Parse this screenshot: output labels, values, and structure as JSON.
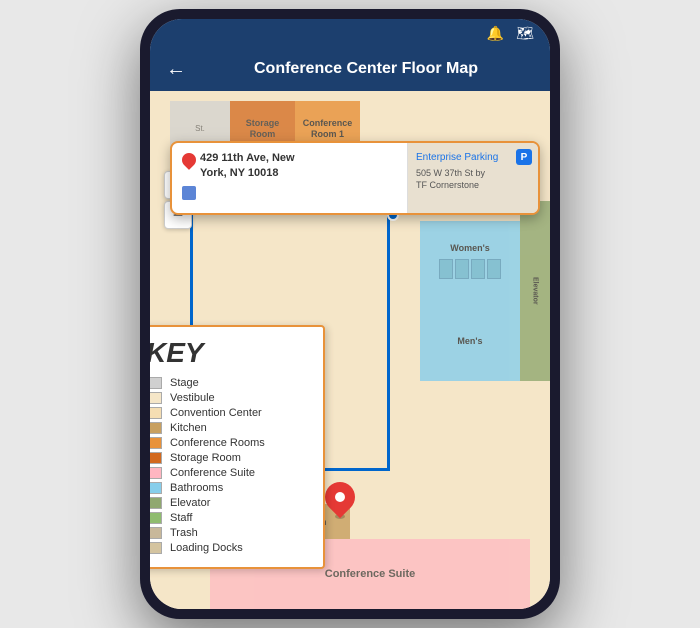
{
  "phone": {
    "nav": {
      "back_label": "←",
      "title": "Conference Center Floor Map",
      "bell_icon": "🔔",
      "map_icon": "🗺"
    }
  },
  "map": {
    "rooms": {
      "storage": "Storage\nRoom",
      "conf1": "Conference\nRoom 1",
      "stage": "St.",
      "womens": "Women's",
      "mens": "Men's",
      "elevator": "Elevator",
      "kitchen": "Kitchen",
      "conf_suite": "Conference Suite"
    },
    "popup": {
      "address_line1": "429 11th Ave, New",
      "address_line2": "York, NY 10018",
      "parking_label": "P",
      "enterprise_line1": "Enterprise Parking",
      "cornerstone_text": "505 W 37th St by\nTF Cornerstone"
    },
    "controls": {
      "zoom_in": "+",
      "zoom_out": "−"
    }
  },
  "key": {
    "title": "KEY",
    "items": [
      {
        "label": "Stage",
        "color": "#d0d0d0"
      },
      {
        "label": "Vestibule",
        "color": "#f5e6c8"
      },
      {
        "label": "Convention Center",
        "color": "#f5deb3"
      },
      {
        "label": "Kitchen",
        "color": "#c8a060"
      },
      {
        "label": "Conference Rooms",
        "color": "#e8923a"
      },
      {
        "label": "Storage Room",
        "color": "#d2691e"
      },
      {
        "label": "Conference Suite",
        "color": "#ffb6c1"
      },
      {
        "label": "Bathrooms",
        "color": "#87ceeb"
      },
      {
        "label": "Elevator",
        "color": "#90a870"
      },
      {
        "label": "Staff",
        "color": "#8fbc6f"
      },
      {
        "label": "Trash",
        "color": "#c8b89a"
      },
      {
        "label": "Loading Docks",
        "color": "#d4c4a0"
      }
    ]
  }
}
